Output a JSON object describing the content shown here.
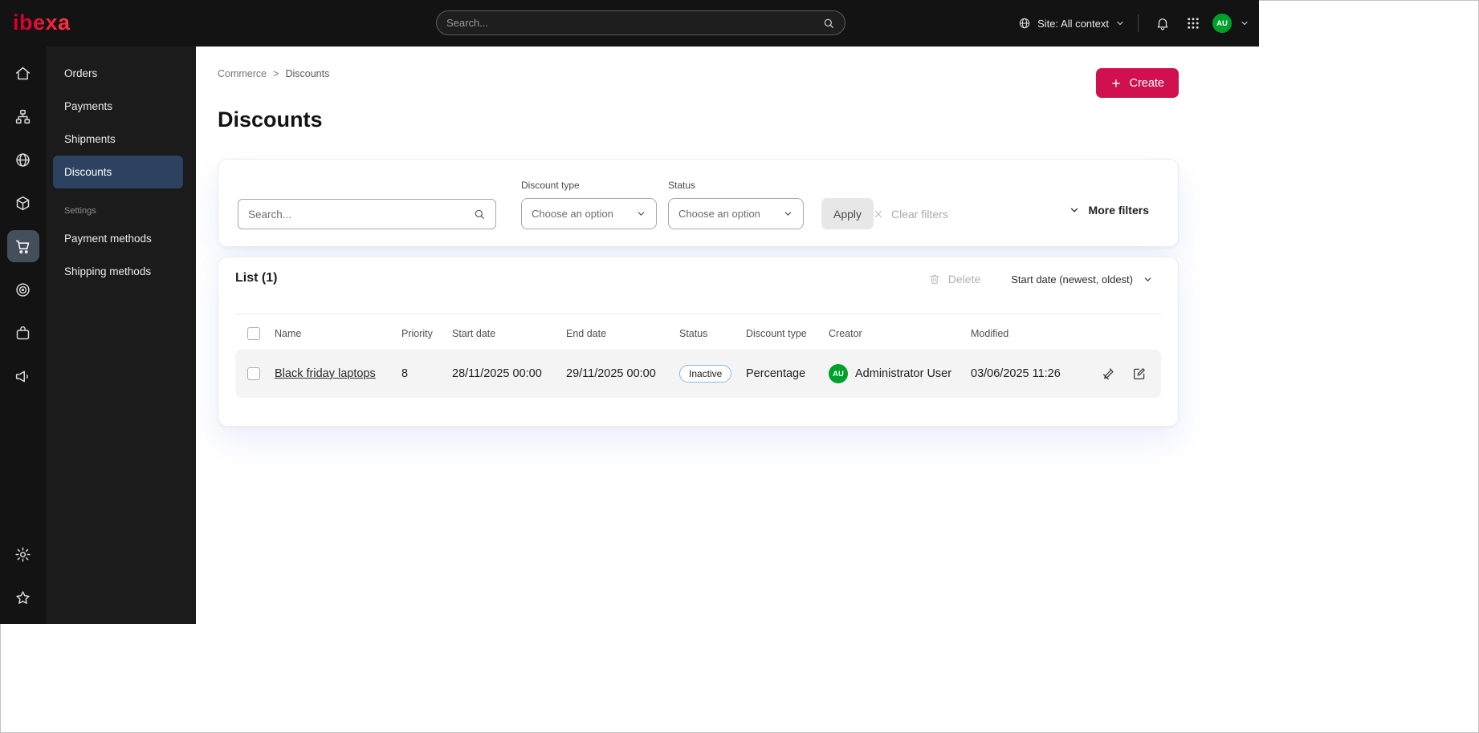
{
  "colors": {
    "brand": "#e00a3c",
    "accent_button": "#d0104f",
    "topbar_bg": "#131313",
    "sidebar_bg": "#1b1b1b",
    "active_menu_bg": "#2d4161",
    "active_rail_bg": "#454f5b",
    "badge_border": "#8ab4f8",
    "avatar_green": "#00a12b"
  },
  "topbar": {
    "logo_text": "ibexa",
    "search_placeholder": "Search...",
    "site_context_label": "Site: All context",
    "avatar_initials": "AU"
  },
  "sidebar": {
    "menu_items": [
      {
        "label": "Orders"
      },
      {
        "label": "Payments"
      },
      {
        "label": "Shipments"
      },
      {
        "label": "Discounts"
      }
    ],
    "section_label": "Settings",
    "section_items": [
      {
        "label": "Payment methods"
      },
      {
        "label": "Shipping methods"
      }
    ]
  },
  "breadcrumb": {
    "crumbs": [
      "Commerce",
      "Discounts"
    ],
    "separator": ">"
  },
  "page": {
    "title": "Discounts"
  },
  "actions": {
    "create_label": "Create"
  },
  "filters": {
    "search_placeholder": "Search...",
    "discount_type": {
      "label": "Discount type",
      "value": "Choose an option"
    },
    "status": {
      "label": "Status",
      "value": "Choose an option"
    },
    "apply_label": "Apply",
    "clear_filters_label": "Clear filters",
    "more_filters_label": "More filters"
  },
  "list": {
    "title": "List (1)",
    "delete_label": "Delete",
    "sort_label": "Start date (newest, oldest)",
    "columns": [
      "Name",
      "Priority",
      "Start date",
      "End date",
      "Status",
      "Discount type",
      "Creator",
      "Modified"
    ],
    "rows": [
      {
        "name": "Black friday laptops",
        "priority": "8",
        "start_date": "28/11/2025 00:00",
        "end_date": "29/11/2025 00:00",
        "status": "Inactive",
        "discount_type": "Percentage",
        "creator_initials": "AU",
        "creator": "Administrator User",
        "modified": "03/06/2025 11:26"
      }
    ]
  },
  "icons": {
    "topbar": [
      "search-icon",
      "globe-icon",
      "chevron-down-icon",
      "bell-icon",
      "apps-grid-icon",
      "avatar",
      "chevron-down-icon"
    ],
    "rail": [
      "home-icon",
      "sitemap-icon",
      "globe-icon",
      "box-icon",
      "cart-icon",
      "target-icon",
      "bag-icon",
      "megaphone-icon",
      "gear-icon",
      "star-icon"
    ],
    "content": [
      "plus-icon",
      "search-icon",
      "chevron-down-icon",
      "x-icon",
      "trash-icon",
      "checkbox",
      "pen-slash-icon",
      "edit-icon"
    ]
  }
}
